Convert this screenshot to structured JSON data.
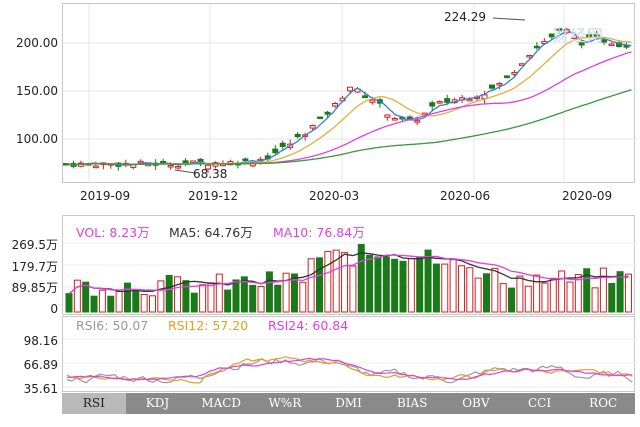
{
  "main_chart": {
    "y_ticks": [
      "200.00",
      "150.00",
      "100.00"
    ],
    "x_ticks": [
      "2019-09",
      "2019-12",
      "2020-03",
      "2020-06",
      "2020-09"
    ],
    "high_label": "224.29",
    "low_label": "68.38",
    "watermark": "财经网"
  },
  "volume": {
    "vol_label": "VOL: 8.23万",
    "ma5_label": "MA5: 64.76万",
    "ma10_label": "MA10: 76.84万",
    "y_ticks": [
      "269.5万",
      "179.7万",
      "89.85万",
      "0"
    ],
    "colors": {
      "vol": "#e040e0",
      "ma5": "#333333",
      "ma10": "#e040e0",
      "up": "#d02020",
      "down": "#1a7a1a"
    }
  },
  "rsi": {
    "rsi6_label": "RSI6: 50.07",
    "rsi12_label": "RSI12: 57.20",
    "rsi24_label": "RSI24: 60.84",
    "y_ticks": [
      "98.16",
      "66.89",
      "35.61"
    ],
    "colors": {
      "rsi6": "#9a9a9a",
      "rsi12": "#e0a020",
      "rsi24": "#e040e0"
    }
  },
  "tabs": [
    "RSI",
    "KDJ",
    "MACD",
    "W%R",
    "DMI",
    "BIAS",
    "OBV",
    "CCI",
    "ROC"
  ],
  "active_tab": "RSI"
}
